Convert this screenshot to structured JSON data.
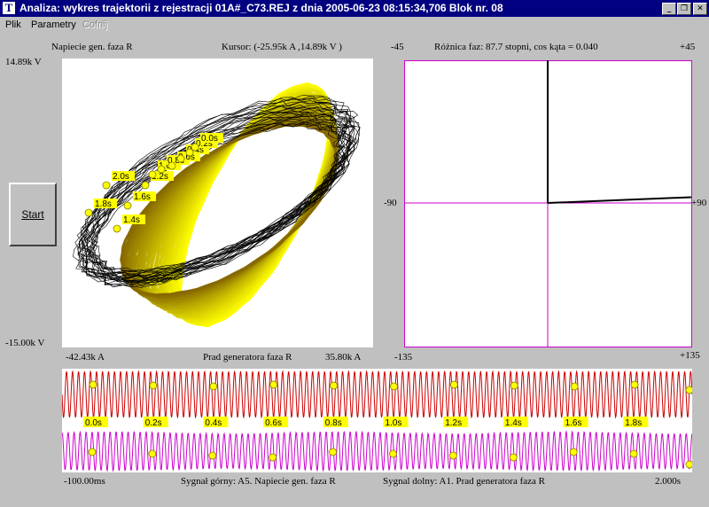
{
  "window": {
    "title": "Analiza: wykres trajektorii z rejestracji 01A#_C73.REJ z dnia 2005-06-23 08:15:34,706 Blok nr.  08",
    "app_icon_letter": "T",
    "controls": {
      "minimize": "_",
      "restore": "❐",
      "close": "✕"
    }
  },
  "menu": {
    "items": [
      {
        "label": "Plik",
        "enabled": true
      },
      {
        "label": "Parametry",
        "enabled": true
      },
      {
        "label": "Cofnij",
        "enabled": false
      }
    ]
  },
  "trajectory_panel": {
    "y_title": "Napiecie gen. faza R",
    "cursor_readout": "Kursor: (-25.95k A ,14.89k V )",
    "y_max_label": "14.89k V",
    "y_min_label": "-15.00k V",
    "x_min_label": "-42.43k A",
    "x_title": "Prad generatora faza R",
    "x_max_label": "35.80k A",
    "time_markers": [
      "2.0s",
      "1.8s",
      "1.6s",
      "1.4s",
      "1.2s",
      "1.0s",
      "0.8s",
      "0.6s",
      "0.4s",
      "0.2s",
      "0.0s"
    ]
  },
  "phase_panel": {
    "title": "Różnica faz: 87.7 stopni, cos kąta = 0.040",
    "top_left": "-45",
    "top_right": "+45",
    "mid_left": "-90",
    "mid_right": "+90",
    "bottom_left": "-135",
    "bottom_right": "+135",
    "phase_deg": 87.7,
    "cos_phi": 0.04
  },
  "signal_panel": {
    "time_start": "-100.00ms",
    "time_end": "2.000s",
    "top_signal_label": "Sygnał górny: A5. Napiecie gen. faza R",
    "bottom_signal_label": "Sygnal dolny: A1. Prad generatora faza R",
    "time_ticks": [
      "0.0s",
      "0.2s",
      "0.4s",
      "0.6s",
      "0.8s",
      "1.0s",
      "1.2s",
      "1.4s",
      "1.6s",
      "1.8s"
    ],
    "colors": {
      "top": "#cc0000",
      "bottom": "#cc00cc",
      "marker": "#ffff00"
    }
  },
  "start_button": {
    "label": "Start"
  },
  "colors": {
    "trajectory_dark": "#000000",
    "trajectory_light": "#ffff00",
    "phase_axes": "#cc00cc",
    "window_bg": "#c0c0c0",
    "titlebar": "#000080"
  }
}
